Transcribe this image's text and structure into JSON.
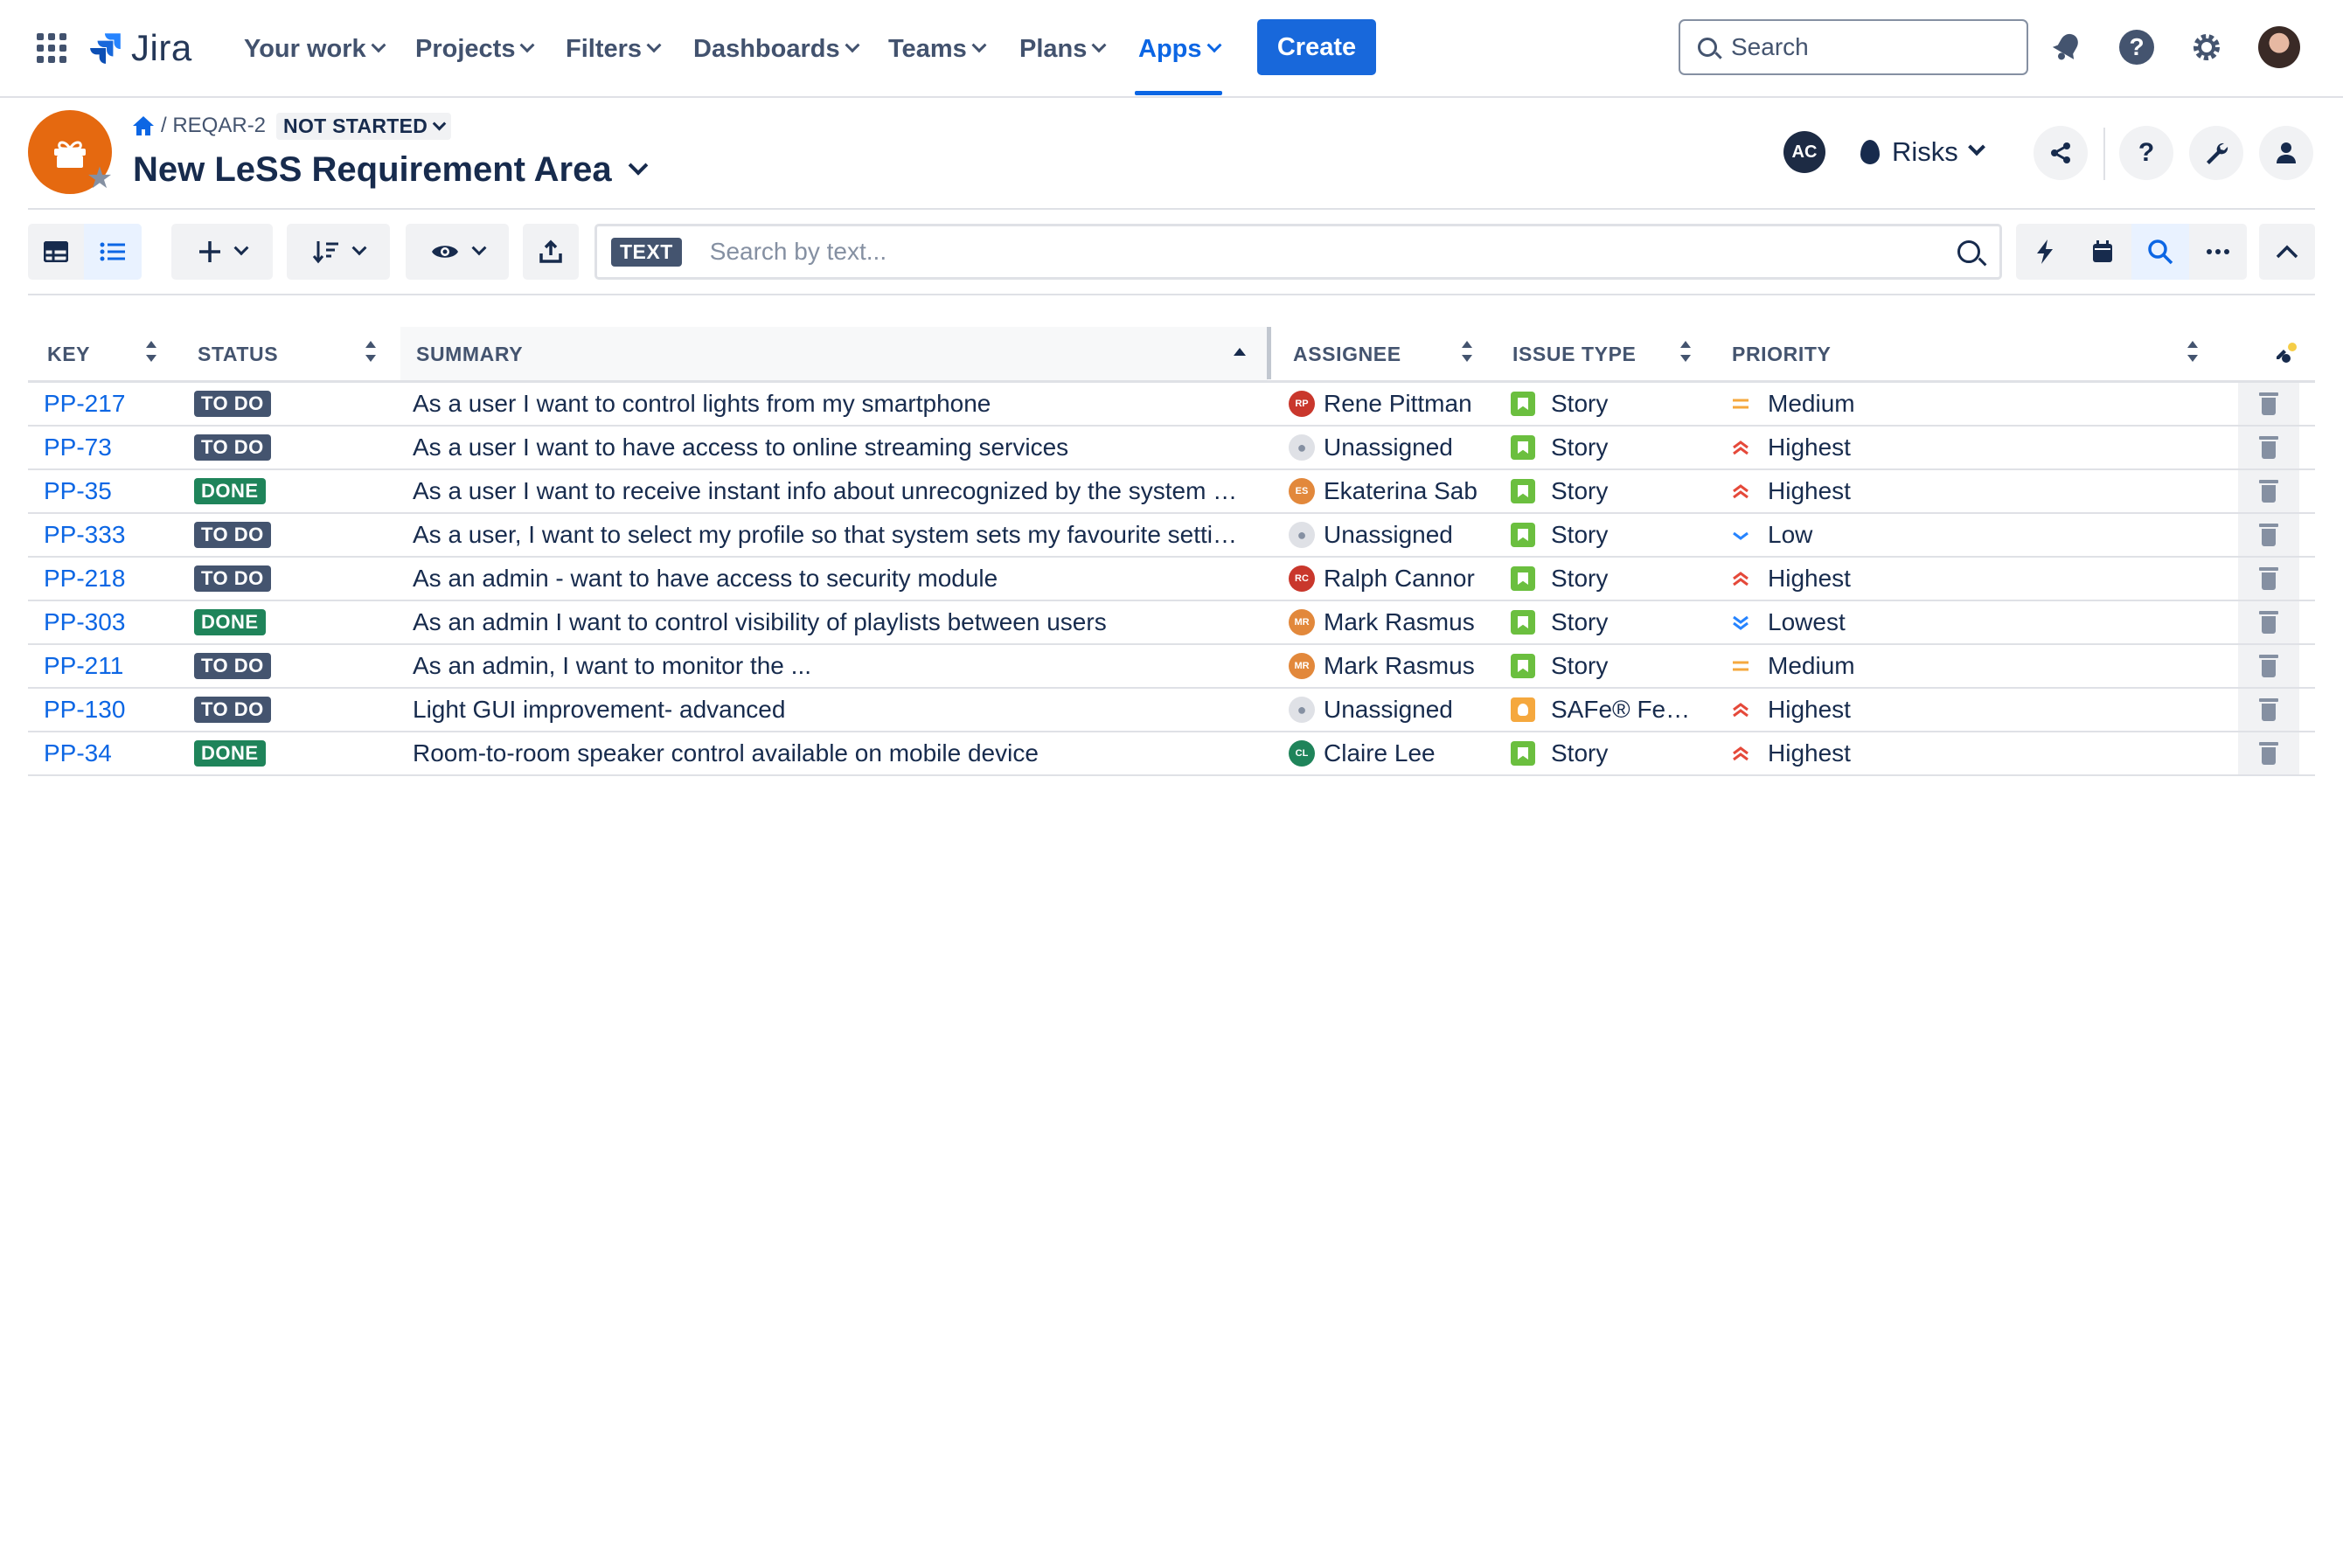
{
  "nav": {
    "logo_text": "Jira",
    "items": [
      {
        "label": "Your work"
      },
      {
        "label": "Projects"
      },
      {
        "label": "Filters"
      },
      {
        "label": "Dashboards"
      },
      {
        "label": "Teams"
      },
      {
        "label": "Plans"
      },
      {
        "label": "Apps",
        "active": true
      }
    ],
    "create_label": "Create",
    "search_placeholder": "Search",
    "accent_color": "#0c66e4"
  },
  "header": {
    "breadcrumb_key": "REQAR-2",
    "status": "NOT STARTED",
    "title": "New LeSS Requirement Area",
    "ac_initials": "AC",
    "risks_label": "Risks",
    "help_label": "?"
  },
  "toolbar": {
    "text_tag": "TEXT",
    "search_placeholder": "Search by text..."
  },
  "table": {
    "columns": [
      "KEY",
      "STATUS",
      "SUMMARY",
      "ASSIGNEE",
      "ISSUE TYPE",
      "PRIORITY"
    ],
    "rows": [
      {
        "key": "PP-217",
        "status": "TO DO",
        "summary": "As a user I want to control lights from my smartphone",
        "assignee": "Rene Pittman",
        "initials": "RP",
        "avatar_color": "#c9372c",
        "type": "Story",
        "priority": "Medium"
      },
      {
        "key": "PP-73",
        "status": "TO DO",
        "summary": "As a user I want to have access to online streaming services",
        "assignee": "Unassigned",
        "initials": "",
        "avatar_color": "",
        "type": "Story",
        "priority": "Highest"
      },
      {
        "key": "PP-35",
        "status": "DONE",
        "summary": "As a user I want to receive instant info about unrecognized by the system …",
        "assignee": "Ekaterina Sab",
        "initials": "ES",
        "avatar_color": "#e2883b",
        "type": "Story",
        "priority": "Highest"
      },
      {
        "key": "PP-333",
        "status": "TO DO",
        "summary": "As a user, I want to select my profile so that system sets my favourite setti…",
        "assignee": "Unassigned",
        "initials": "",
        "avatar_color": "",
        "type": "Story",
        "priority": "Low"
      },
      {
        "key": "PP-218",
        "status": "TO DO",
        "summary": "As an admin - want to have access to security module",
        "assignee": "Ralph Cannor",
        "initials": "RC",
        "avatar_color": "#c9372c",
        "type": "Story",
        "priority": "Highest"
      },
      {
        "key": "PP-303",
        "status": "DONE",
        "summary": "As an admin I want to control visibility of playlists between users",
        "assignee": "Mark Rasmus",
        "initials": "MR",
        "avatar_color": "#e2883b",
        "type": "Story",
        "priority": "Lowest"
      },
      {
        "key": "PP-211",
        "status": "TO DO",
        "summary": "As an admin, I want to monitor the ...",
        "assignee": "Mark Rasmus",
        "initials": "MR",
        "avatar_color": "#e2883b",
        "type": "Story",
        "priority": "Medium"
      },
      {
        "key": "PP-130",
        "status": "TO DO",
        "summary": "Light GUI improvement- advanced",
        "assignee": "Unassigned",
        "initials": "",
        "avatar_color": "",
        "type": "SAFe® Fe…",
        "priority": "Highest"
      },
      {
        "key": "PP-34",
        "status": "DONE",
        "summary": "Room-to-room speaker control available on mobile device",
        "assignee": "Claire Lee",
        "initials": "CL",
        "avatar_color": "#1f845a",
        "type": "Story",
        "priority": "Highest"
      }
    ]
  },
  "colors": {
    "todo": "#44546f",
    "done": "#1f845a",
    "story": "#6bbf3f",
    "feature": "#f5a83e",
    "medium": "#f5a83e",
    "highest": "#e5493a",
    "low": "#2684ff",
    "lowest": "#2684ff"
  }
}
